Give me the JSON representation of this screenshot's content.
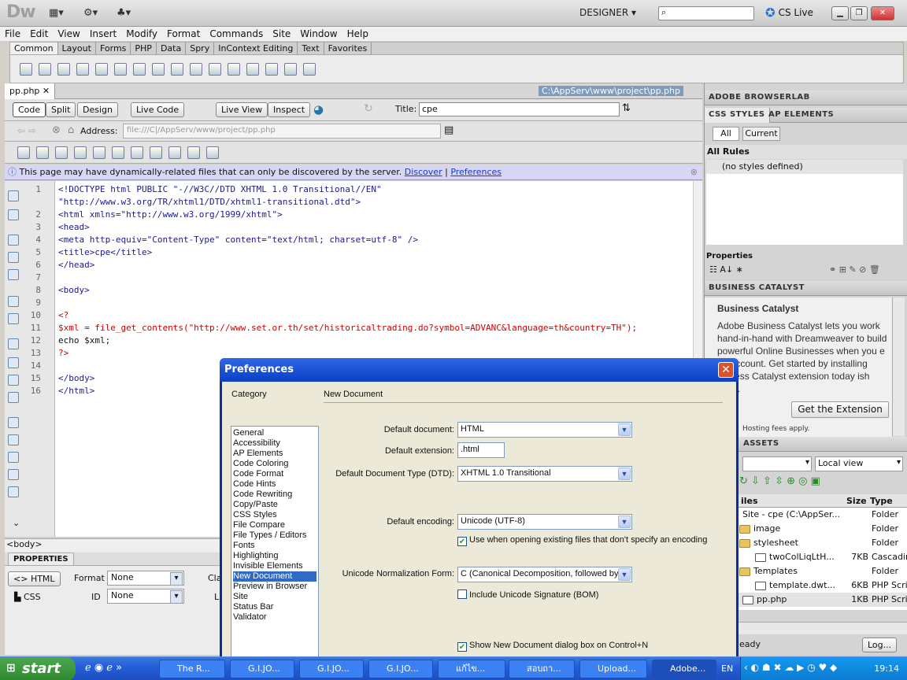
{
  "app": {
    "logo": "Dw",
    "workspace": "DESIGNER",
    "cs_live": "CS Live"
  },
  "menu": [
    "File",
    "Edit",
    "View",
    "Insert",
    "Modify",
    "Format",
    "Commands",
    "Site",
    "Window",
    "Help"
  ],
  "insert_tabs": [
    "Common",
    "Layout",
    "Forms",
    "PHP",
    "Data",
    "Spry",
    "InContext Editing",
    "Text",
    "Favorites"
  ],
  "doc": {
    "tab": "pp.php",
    "path": "C:\\AppServ\\www\\project\\pp.php",
    "title_label": "Title:",
    "title_value": "cpe",
    "views": [
      "Code",
      "Split",
      "Design"
    ],
    "live_code": "Live Code",
    "live_view": "Live View",
    "inspect": "Inspect",
    "address_label": "Address:",
    "address_value": "file:///C|/AppServ/www/project/pp.php"
  },
  "infobar": {
    "text": "This page may have dynamically-related files that can only be discovered by the server.",
    "discover": "Discover",
    "sep": "|",
    "prefs": "Preferences"
  },
  "code_lines": [
    {
      "n": "1",
      "t": "<!DOCTYPE html PUBLIC \"-//W3C//DTD XHTML 1.0 Transitional//EN\""
    },
    {
      "n": "",
      "t": "\"http://www.w3.org/TR/xhtml1/DTD/xhtml1-transitional.dtd\">"
    },
    {
      "n": "2",
      "t": "<html xmlns=\"http://www.w3.org/1999/xhtml\">"
    },
    {
      "n": "3",
      "t": "<head>"
    },
    {
      "n": "4",
      "t": "<meta http-equiv=\"Content-Type\" content=\"text/html; charset=utf-8\" />"
    },
    {
      "n": "5",
      "t": "<title>cpe</title>"
    },
    {
      "n": "6",
      "t": "</head>"
    },
    {
      "n": "7",
      "t": ""
    },
    {
      "n": "8",
      "t": "<body>"
    },
    {
      "n": "9",
      "t": ""
    },
    {
      "n": "10",
      "t": "<?"
    },
    {
      "n": "11",
      "t": "$xml = file_get_contents(\"http://www.set.or.th/set/historicaltrading.do?symbol=ADVANC&language=th&country=TH\");"
    },
    {
      "n": "12",
      "t": "echo $xml;"
    },
    {
      "n": "13",
      "t": "?>"
    },
    {
      "n": "14",
      "t": ""
    },
    {
      "n": "15",
      "t": "</body>"
    },
    {
      "n": "16",
      "t": "</html>"
    }
  ],
  "tag_selector": "<body>",
  "properties": {
    "header": "PROPERTIES",
    "html": "HTML",
    "css": "CSS",
    "format_label": "Format",
    "format_value": "None",
    "id_label": "ID",
    "id_value": "None",
    "class_label": "Cla",
    "link_label": "L"
  },
  "rpanel": {
    "browserlab": "ADOBE BROWSERLAB",
    "css_styles": "CSS STYLES",
    "ap_elements": "AP ELEMENTS",
    "all": "All",
    "current": "Current",
    "all_rules": "All Rules",
    "no_styles": "(no styles defined)",
    "properties": "Properties",
    "bc_header": "BUSINESS CATALYST",
    "bc_title": "Business Catalyst",
    "bc_text": "Adobe Business Catalyst lets you work hand-in-hand with Dreamweaver to build powerful Online Businesses when you e an account. Get started by installing usiness Catalyst extension today ish only).",
    "get_ext": "Get the Extension",
    "hosting": "Hosting fees apply.",
    "assets": "ASSETS",
    "local_view": "Local view",
    "files_cols": [
      "iles",
      "Size",
      "Type"
    ],
    "files": [
      {
        "name": "Site - cpe (C:\\AppSer...",
        "size": "",
        "type": "Folder"
      },
      {
        "name": "image",
        "size": "",
        "type": "Folder"
      },
      {
        "name": "stylesheet",
        "size": "",
        "type": "Folder"
      },
      {
        "name": "twoColLiqLtH...",
        "size": "7KB",
        "type": "Cascadir"
      },
      {
        "name": "Templates",
        "size": "",
        "type": "Folder"
      },
      {
        "name": "template.dwt...",
        "size": "6KB",
        "type": "PHP Scri"
      },
      {
        "name": "pp.php",
        "size": "1KB",
        "type": "PHP Scri"
      }
    ],
    "status": "eady",
    "log": "Log..."
  },
  "dialog": {
    "title": "Preferences",
    "category_label": "Category",
    "section": "New Document",
    "categories": [
      "General",
      "Accessibility",
      "AP Elements",
      "Code Coloring",
      "Code Format",
      "Code Hints",
      "Code Rewriting",
      "Copy/Paste",
      "CSS Styles",
      "File Compare",
      "File Types / Editors",
      "Fonts",
      "Highlighting",
      "Invisible Elements",
      "New Document",
      "Preview in Browser",
      "Site",
      "Status Bar",
      "Validator"
    ],
    "default_doc_label": "Default document:",
    "default_doc": "HTML",
    "default_ext_label": "Default extension:",
    "default_ext": ".html",
    "dtd_label": "Default Document Type (DTD):",
    "dtd": "XHTML 1.0 Transitional",
    "enc_label": "Default encoding:",
    "enc": "Unicode (UTF-8)",
    "use_enc": "Use when opening existing files that don't specify an encoding",
    "norm_label": "Unicode Normalization Form:",
    "norm": "C (Canonical Decomposition, followed by C",
    "bom": "Include Unicode Signature (BOM)",
    "show_dialog": "Show New Document dialog box on Control+N"
  },
  "taskbar": {
    "start": "start",
    "tasks": [
      "The R...",
      "G.I.JO...",
      "G.I.JO...",
      "G.I.JO...",
      "แก้ไข...",
      "สอบถา...",
      "Upload...",
      "Adobe..."
    ],
    "lang": "EN",
    "clock": "19:14"
  }
}
